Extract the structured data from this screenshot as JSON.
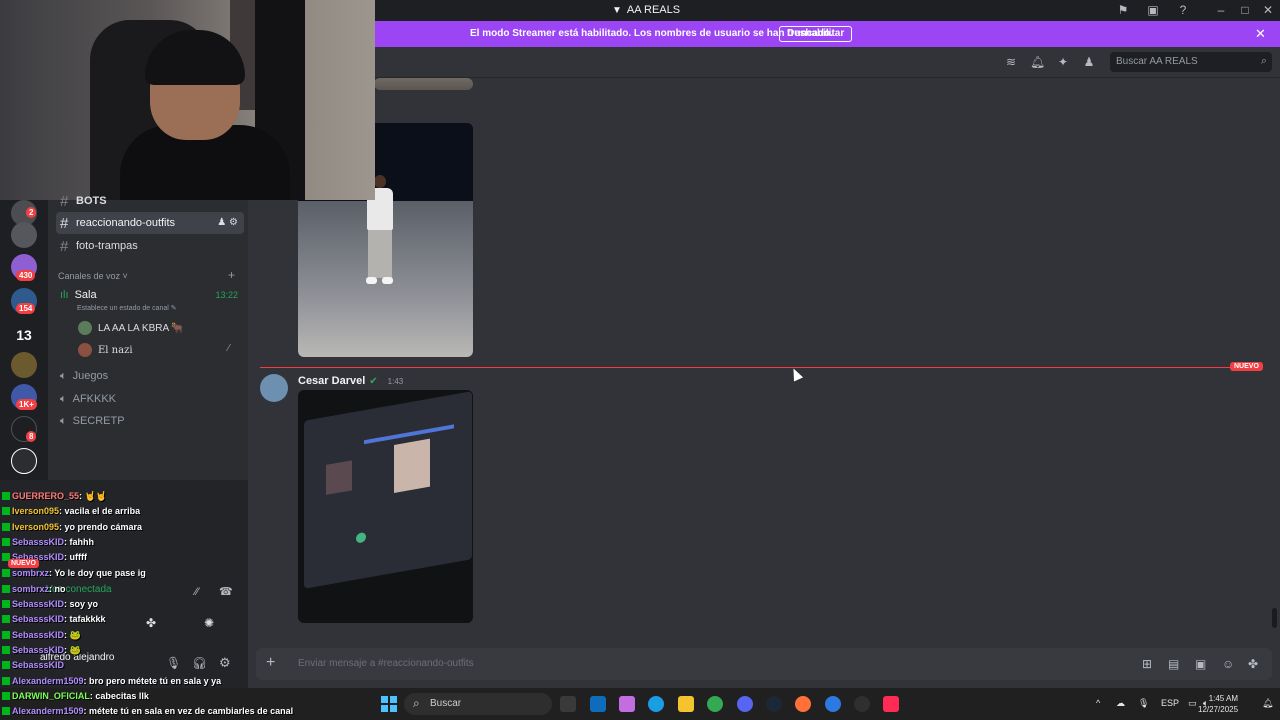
{
  "window": {
    "title": "AA REALS"
  },
  "banner": {
    "message": "El modo Streamer está habilitado. Los nombres de usuario se han truncado.",
    "button": "Deshabilitar"
  },
  "header": {
    "search_placeholder": "Buscar AA REALS"
  },
  "rail": {
    "badges": [
      "2",
      "430",
      "154",
      "1K+",
      "8"
    ],
    "project_label": "13"
  },
  "channels": {
    "text": [
      {
        "name": "BOTS"
      },
      {
        "name": "reaccionando-outfits"
      },
      {
        "name": "foto-trampas"
      }
    ],
    "voice_category": "Canales de voz",
    "voice_main": {
      "name": "Sala",
      "time": "13:22",
      "status": "Establece un estado de canal"
    },
    "voice_users": [
      "LA AA LA KBRA 🐂",
      "El nazi"
    ],
    "voice_other": [
      "Juegos",
      "AFKKKK",
      "SECRETP"
    ]
  },
  "voice_bar": {
    "status": "Voz conectada"
  },
  "user_bar": {
    "name": "alfredo alejandro"
  },
  "overlay_chat": [
    {
      "user": "GUERRERO_55",
      "text": ": 🤘🤘"
    },
    {
      "user": "Iverson095",
      "text": ": vacila el de arriba"
    },
    {
      "user": "Iverson095",
      "text": ": yo prendo cámara"
    },
    {
      "user": "SebasssKID",
      "text": ": fahhh"
    },
    {
      "user": "SebasssKID",
      "text": ": uffff"
    },
    {
      "user": "sombrxz",
      "text": ": Yo le doy que pase ig"
    },
    {
      "user": "sombrxz",
      "text": ": no"
    },
    {
      "user": "SebasssKID",
      "text": ": soy yo"
    },
    {
      "user": "SebasssKID",
      "text": ": tafakkkk"
    },
    {
      "user": "SebasssKID",
      "text": ": 🐸"
    },
    {
      "user": "SebasssKID",
      "text": ": 🐸"
    },
    {
      "user": "SebasssKID",
      "text": ""
    },
    {
      "user": "Alexanderm1509",
      "text": ": bro pero métete tú en sala y ya"
    },
    {
      "user": "DARWIN_OFICIAL",
      "text": ": cabecitas llk"
    },
    {
      "user": "Alexanderm1509",
      "text": ": métete tú en sala en vez de cambiarles de canal"
    }
  ],
  "overlay_new_tag": "NUEVO",
  "messages": {
    "new_label": "NUEVO",
    "author": "Cesar Darvel",
    "timestamp": "1:43"
  },
  "composer": {
    "placeholder": "Enviar mensaje a #reaccionando-outfits"
  },
  "taskbar": {
    "search": "Buscar",
    "lang": "ESP",
    "time": "1:45 AM",
    "date": "12/27/2025"
  }
}
